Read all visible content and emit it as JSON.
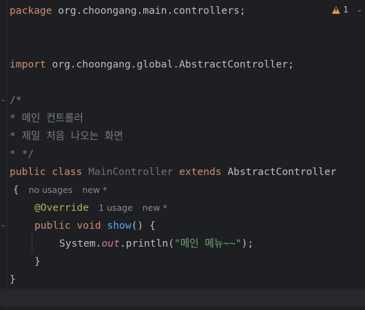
{
  "editor": {
    "warning_count": "1",
    "lines": {
      "pkg_kw": "package",
      "pkg_name": " org.choongang.main.controllers;",
      "imp_kw": "import",
      "imp_name": " org.choongang.global.AbstractController;",
      "cmt_open": "/*",
      "cmt_1": "* 메인 컨트롤러",
      "cmt_2": "* 제일 처음 나오는 화면",
      "cmt_close": "* */",
      "cls_public": "public",
      "cls_class": "class",
      "cls_name": "MainController",
      "cls_extends": "extends",
      "cls_parent": "AbstractController",
      "brace_open": " {",
      "hint_usages_cls": "no usages",
      "hint_new_cls": "new *",
      "override": "@Override",
      "hint_usages_m": "1 usage",
      "hint_new_m": "new *",
      "m_public": "public",
      "m_void": "void",
      "m_name": "show",
      "m_sig": "() {",
      "call_obj": "System.",
      "call_field": "out",
      "call_method": ".println(",
      "call_str": "\"메인 메뉴~~\"",
      "call_end": ");",
      "close_m": "}",
      "close_cls": "}"
    }
  }
}
